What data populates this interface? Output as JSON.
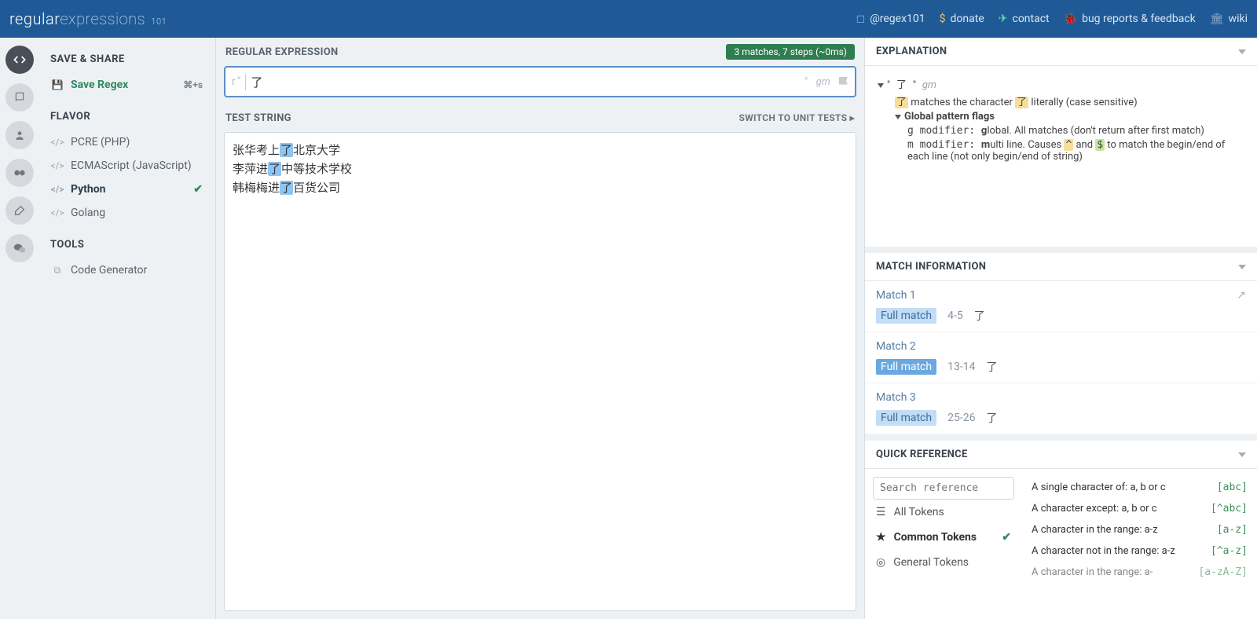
{
  "header": {
    "logo_main": "regular",
    "logo_thin": "expressions",
    "logo_sub": "101",
    "links": [
      {
        "icon": "twitter",
        "label": "@regex101"
      },
      {
        "icon": "dollar",
        "label": "donate"
      },
      {
        "icon": "paper-plane",
        "label": "contact"
      },
      {
        "icon": "bug",
        "label": "bug reports & feedback"
      },
      {
        "icon": "wiki",
        "label": "wiki"
      }
    ]
  },
  "sidebar": {
    "save_share": "SAVE & SHARE",
    "save_regex": "Save Regex",
    "save_shortcut": "⌘+s",
    "flavor_title": "FLAVOR",
    "flavors": [
      {
        "label": "PCRE (PHP)",
        "active": false
      },
      {
        "label": "ECMAScript (JavaScript)",
        "active": false
      },
      {
        "label": "Python",
        "active": true
      },
      {
        "label": "Golang",
        "active": false
      }
    ],
    "tools_title": "TOOLS",
    "tools": [
      {
        "label": "Code Generator"
      }
    ]
  },
  "editor": {
    "regex_title": "REGULAR EXPRESSION",
    "stats": "3 matches, 7 steps (~0ms)",
    "prefix": "r\"",
    "pattern": "了",
    "suffix": "\"",
    "flags": "gm",
    "test_title": "TEST STRING",
    "switch_label": "SWITCH TO UNIT TESTS ▸",
    "test_lines": [
      {
        "pre": "张华考上",
        "hl": "了",
        "post": "北京大学"
      },
      {
        "pre": "李萍进",
        "hl": "了",
        "post": "中等技术学校"
      },
      {
        "pre": "韩梅梅进",
        "hl": "了",
        "post": "百货公司"
      }
    ]
  },
  "explanation": {
    "title": "EXPLANATION",
    "quote_l": "\"",
    "char": "了",
    "quote_r": "\"",
    "flags_disp": "gm",
    "literal_pre": "matches the character ",
    "literal_post": " literally (case sensitive)",
    "gpf_title": "Global pattern flags",
    "g_code": "g modifier: ",
    "g_bold": "g",
    "g_text": "lobal. All matches (don't return after first match)",
    "m_code": "m modifier: ",
    "m_bold": "m",
    "m_text_a": "ulti line. Causes ",
    "m_caret": "^",
    "m_and": " and ",
    "m_dollar": "$",
    "m_text_b": " to match the begin/end of each line (not only begin/end of string)"
  },
  "match_info": {
    "title": "MATCH INFORMATION",
    "full_label": "Full match",
    "matches": [
      {
        "name": "Match 1",
        "range": "4-5",
        "text": "了",
        "selected": false
      },
      {
        "name": "Match 2",
        "range": "13-14",
        "text": "了",
        "selected": true
      },
      {
        "name": "Match 3",
        "range": "25-26",
        "text": "了",
        "selected": false
      }
    ]
  },
  "quickref": {
    "title": "QUICK REFERENCE",
    "search_placeholder": "Search reference",
    "categories": [
      {
        "label": "All Tokens",
        "active": false
      },
      {
        "label": "Common Tokens",
        "active": true
      },
      {
        "label": "General Tokens",
        "active": false
      }
    ],
    "items": [
      {
        "desc": "A single character of: a, b or c",
        "code": "[abc]"
      },
      {
        "desc": "A character except: a, b or c",
        "code": "[^abc]"
      },
      {
        "desc": "A character in the range: a-z",
        "code": "[a-z]"
      },
      {
        "desc": "A character not in the range: a-z",
        "code": "[^a-z]"
      },
      {
        "desc": "A character in the range: a-",
        "code": "[a-zA-Z]"
      }
    ]
  }
}
